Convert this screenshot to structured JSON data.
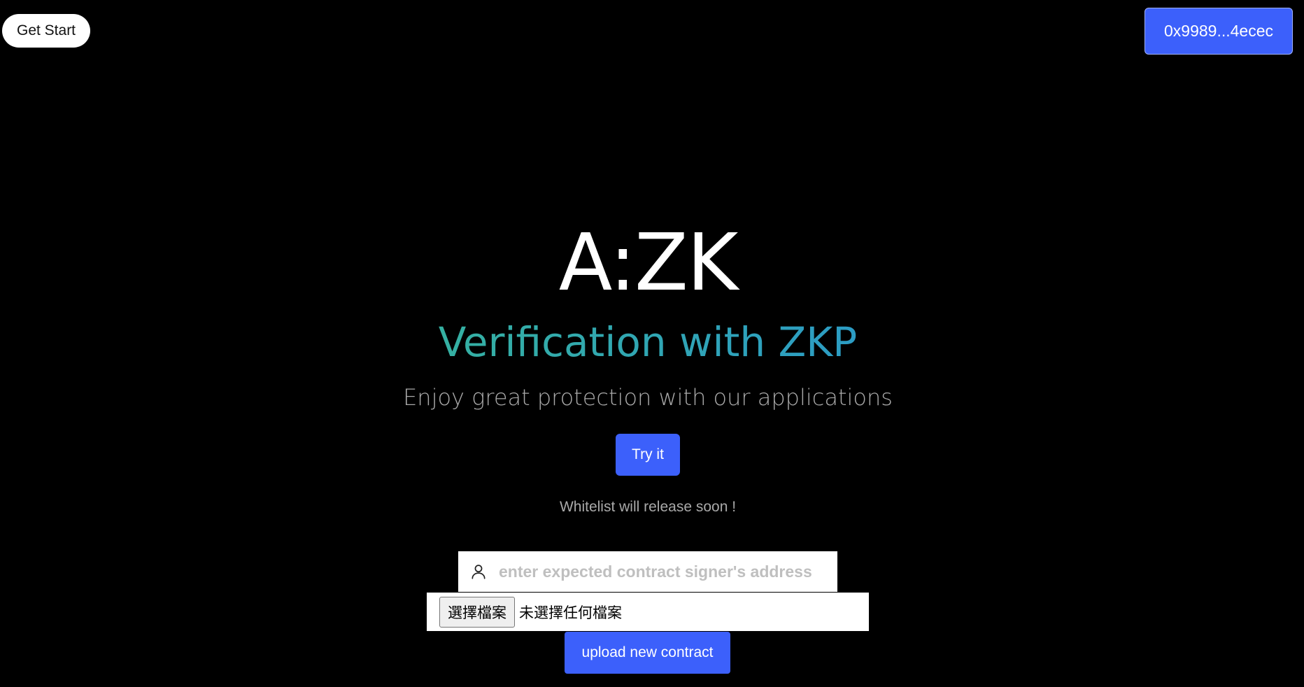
{
  "header": {
    "get_start_label": "Get Start",
    "wallet_address": "0x9989...4ecec"
  },
  "hero": {
    "title": "A:ZK",
    "subtitle": "Verification with ZKP",
    "tagline": "Enjoy great protection with our applications",
    "try_label": "Try it",
    "whitelist_text": "Whitelist will release soon !"
  },
  "upload_form": {
    "address_placeholder": "enter expected contract signer's address",
    "address_value": "",
    "address_icon": "user-icon",
    "file_button_label": "選擇檔案",
    "file_status": "未選擇任何檔案",
    "upload_label": "upload new contract"
  },
  "colors": {
    "background": "#000000",
    "accent": "#3c60fb",
    "subtitle_gradient_start": "#35b0a2",
    "subtitle_gradient_end": "#2c9cc4",
    "muted_text": "#a9a9a9"
  }
}
